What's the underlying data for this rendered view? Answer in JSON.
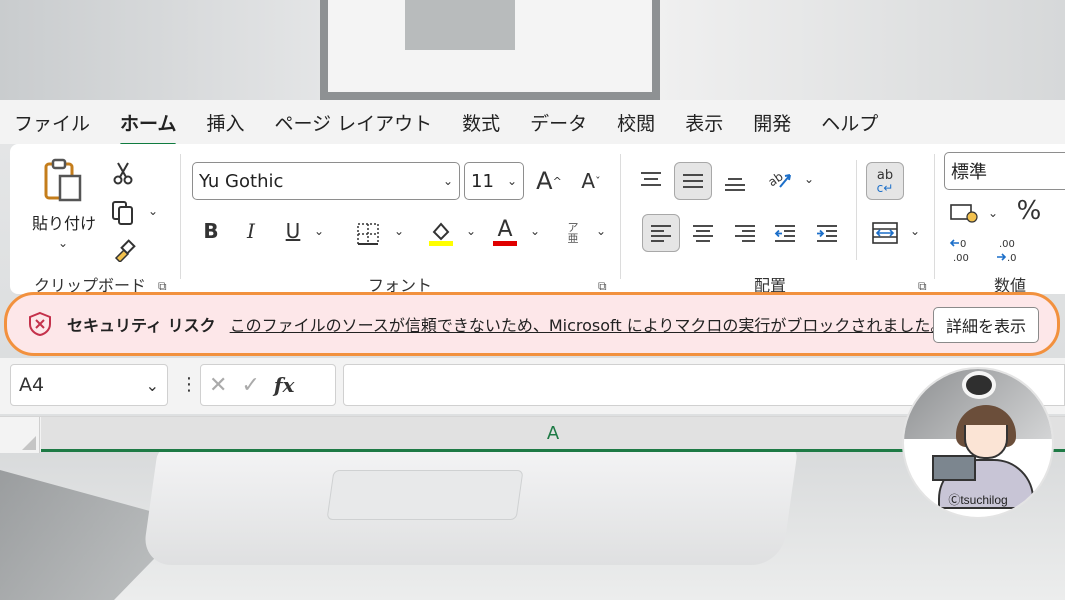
{
  "ribbon_tabs": [
    {
      "label": "ファイル",
      "active": false
    },
    {
      "label": "ホーム",
      "active": true
    },
    {
      "label": "挿入",
      "active": false
    },
    {
      "label": "ページ レイアウト",
      "active": false
    },
    {
      "label": "数式",
      "active": false
    },
    {
      "label": "データ",
      "active": false
    },
    {
      "label": "校閲",
      "active": false
    },
    {
      "label": "表示",
      "active": false
    },
    {
      "label": "開発",
      "active": false
    },
    {
      "label": "ヘルプ",
      "active": false
    }
  ],
  "clipboard": {
    "paste_label": "貼り付け",
    "group_label": "クリップボード"
  },
  "font": {
    "font_name": "Yu Gothic",
    "font_size": "11",
    "group_label": "フォント",
    "bold": "B",
    "italic": "I",
    "underline": "U",
    "grow": "A",
    "shrink": "A",
    "font_color": "A",
    "furigana_top": "ア",
    "furigana_bottom": "亜"
  },
  "alignment": {
    "group_label": "配置",
    "wrap": "ab"
  },
  "number": {
    "format": "標準",
    "group_label": "数値",
    "percent": "%"
  },
  "security_banner": {
    "title": "セキュリティ リスク",
    "message": "このファイルのソースが信頼できないため、Microsoft によりマクロの実行がブロックされました。",
    "button": "詳細を表示"
  },
  "formula_bar": {
    "name_box": "A4",
    "value": ""
  },
  "column_header": "A",
  "watermark": "Ⓒtsuchilog",
  "colors": {
    "accent_green": "#1e7a45",
    "banner_bg": "#fde7e9",
    "highlight_orange": "#f2913e",
    "shield_red": "#c4314b"
  }
}
